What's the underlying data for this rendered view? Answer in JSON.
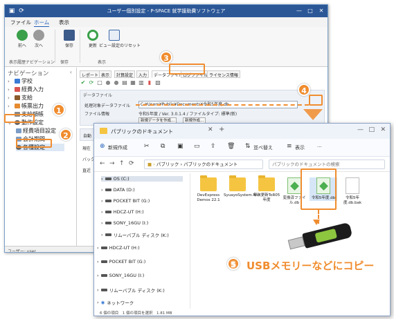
{
  "app": {
    "title": "ユーザー個別設定 - P-SPACE 就学援助費ソフトウェア",
    "menu_tabs": [
      "ファイル",
      "ホーム",
      "表示"
    ],
    "ribbon": {
      "back": "前へ",
      "forward": "次へ",
      "save": "保存",
      "refresh": "更新",
      "view_reset": "ビュー設定のリセット",
      "groups": [
        "表示履歴ナビゲーション",
        "保存",
        "表示"
      ]
    },
    "nav": {
      "header": "ナビゲーション",
      "items": [
        "学校",
        "経費入力",
        "支給",
        "帳票出力",
        "支給額帳",
        "動作設定",
        "経費項目設定",
        "会計期間",
        "各種設定"
      ]
    },
    "content_tabs": [
      "レポート",
      "表示",
      "計算設定",
      "入力",
      "データファイル",
      "ログファイル",
      "ライセンス情報"
    ],
    "datafile": {
      "section": "データファイル",
      "target_label": "処理対象データファイル",
      "target_value": "C:¥Users¥Public¥Documents¥令和5年度.db",
      "info_label": "ファイル情報",
      "info_value": "令和5年度 / Ver. 3.0.1.4 / ファイルタイプ: 標準(新)",
      "btn_update": "新規データを作成...",
      "btn_new": "新規作成...",
      "label_auto": "自動",
      "label_now": "現在",
      "label_back": "バック",
      "label_direct": "直近"
    },
    "status": "ユーザー: user"
  },
  "explorer": {
    "title": "パブリックのドキュメント",
    "commands": [
      "新規作成",
      "並べ替え",
      "表示"
    ],
    "address": [
      "パブリック",
      "パブリックのドキュメント"
    ],
    "search_placeholder": "パブリックのドキュメントの検索",
    "tree": [
      "OS (C:)",
      "DATA (D:)",
      "POCKET BIT (G:)",
      "HDCZ-UT (H:)",
      "SONY_16GU (I:)",
      "リムーバブル ディスク (K:)",
      "HDCZ-UT (H:)",
      "POCKET BIT (G:)",
      "SONY_16GU (I:)",
      "リムーバブル ディスク (K:)",
      "ネットワーク"
    ],
    "files": [
      {
        "name": "DevExpress Demos 22.1",
        "kind": "folder"
      },
      {
        "name": "SyuayoSystem.Win",
        "kind": "folder"
      },
      {
        "name": "年次更新ToR05年度",
        "kind": "folder"
      },
      {
        "name": "変換済ファイル.db",
        "kind": "db"
      },
      {
        "name": "令和5年度.db",
        "kind": "db"
      },
      {
        "name": "令和5年度.db.bak",
        "kind": "doc"
      }
    ],
    "status": "6 個の項目　1 個の項目を選択　1.81 MB"
  },
  "annotations": {
    "steps": [
      "1",
      "2",
      "3",
      "4",
      "5"
    ],
    "usb_note": "USBメモリーなどにコピー"
  }
}
